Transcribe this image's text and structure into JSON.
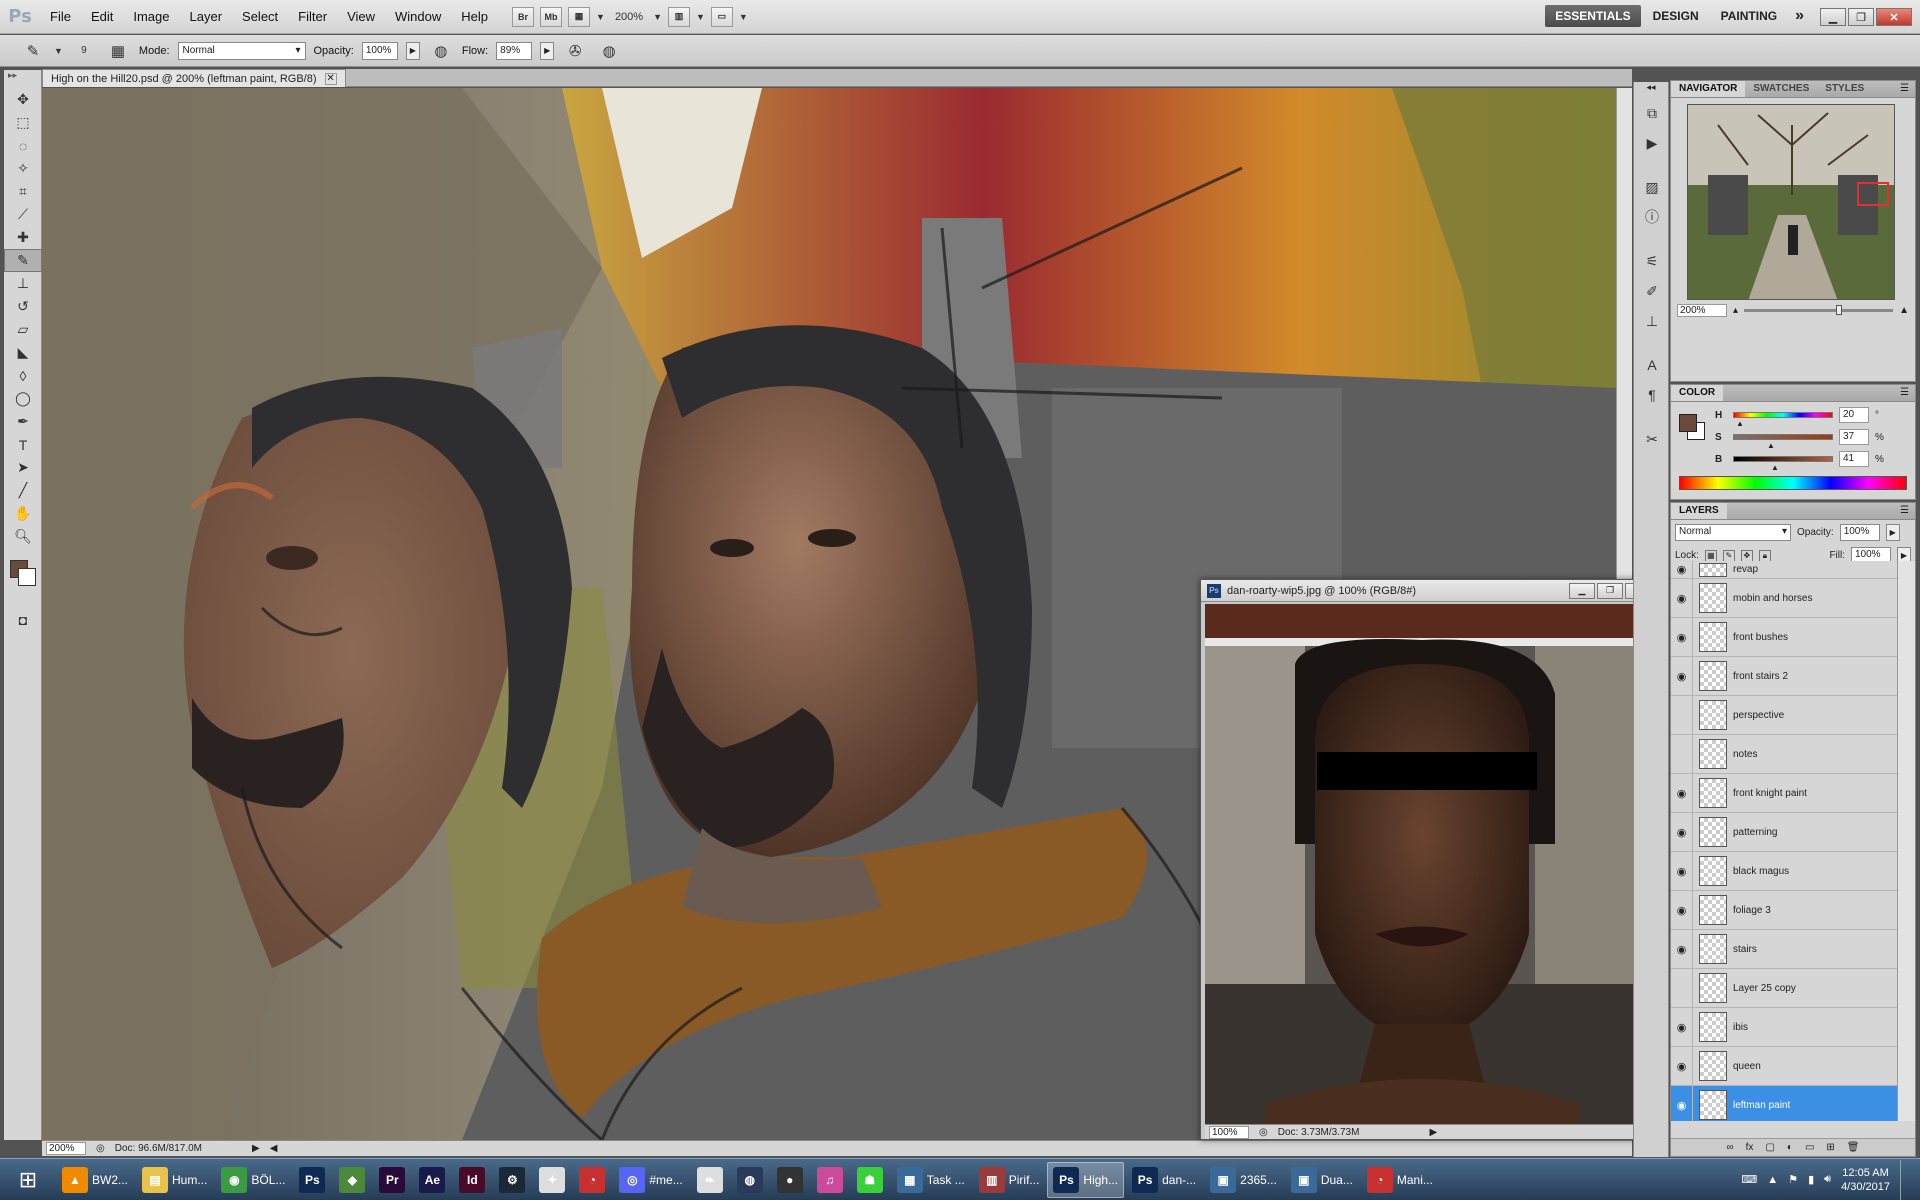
{
  "app": {
    "logo": "Ps",
    "menu": [
      "File",
      "Edit",
      "Image",
      "Layer",
      "Select",
      "Filter",
      "View",
      "Window",
      "Help"
    ],
    "menubar_tools": {
      "br": "Br",
      "mb": "Mb",
      "zoom": "200%"
    },
    "workspaces": [
      "ESSENTIALS",
      "DESIGN",
      "PAINTING"
    ],
    "workspace_more": "»"
  },
  "options_bar": {
    "brush_size": "9",
    "mode_label": "Mode:",
    "mode_value": "Normal",
    "opacity_label": "Opacity:",
    "opacity_value": "100%",
    "flow_label": "Flow:",
    "flow_value": "89%"
  },
  "document": {
    "tab_title": "High on the Hill20.psd @ 200% (leftman paint, RGB/8)",
    "zoom": "200%",
    "doc_size": "Doc: 96.6M/817.0M"
  },
  "reference_window": {
    "title": "dan-roarty-wip5.jpg @ 100% (RGB/8#)",
    "zoom": "100%",
    "doc_size": "Doc: 3.73M/3.73M"
  },
  "navigator": {
    "tabs": [
      "NAVIGATOR",
      "SWATCHES",
      "STYLES"
    ],
    "zoom": "200%"
  },
  "color_panel": {
    "title": "COLOR",
    "channels": [
      {
        "label": "H",
        "value": "20",
        "unit": "°",
        "fraction": 0.06
      },
      {
        "label": "S",
        "value": "37",
        "unit": "%",
        "fraction": 0.37
      },
      {
        "label": "B",
        "value": "41",
        "unit": "%",
        "fraction": 0.41
      }
    ],
    "foreground": "#6b4a3c"
  },
  "layers_panel": {
    "title": "LAYERS",
    "blend_mode": "Normal",
    "opacity_label": "Opacity:",
    "opacity_value": "100%",
    "lock_label": "Lock:",
    "fill_label": "Fill:",
    "fill_value": "100%",
    "layers": [
      {
        "name": "revap",
        "visible": true,
        "selected": false
      },
      {
        "name": "mobin and horses",
        "visible": true,
        "selected": false
      },
      {
        "name": "front bushes",
        "visible": true,
        "selected": false
      },
      {
        "name": "front stairs 2",
        "visible": true,
        "selected": false
      },
      {
        "name": "perspective",
        "visible": false,
        "selected": false
      },
      {
        "name": "notes",
        "visible": false,
        "selected": false
      },
      {
        "name": "front knight paint",
        "visible": true,
        "selected": false
      },
      {
        "name": "patterning",
        "visible": true,
        "selected": false
      },
      {
        "name": "black magus",
        "visible": true,
        "selected": false
      },
      {
        "name": "foliage 3",
        "visible": true,
        "selected": false
      },
      {
        "name": "stairs",
        "visible": true,
        "selected": false
      },
      {
        "name": "Layer 25 copy",
        "visible": false,
        "selected": false
      },
      {
        "name": "ibis",
        "visible": true,
        "selected": false
      },
      {
        "name": "queen",
        "visible": true,
        "selected": false
      },
      {
        "name": "leftman paint",
        "visible": true,
        "selected": true
      }
    ],
    "footer": [
      "∞",
      "fx",
      "▢",
      "◐",
      "▭",
      "⊞",
      "🗑"
    ]
  },
  "taskbar": {
    "items": [
      {
        "icon": "vlc-icon",
        "glyph": "▲",
        "color": "#f08a00",
        "label": "BW2...",
        "active": false
      },
      {
        "icon": "folder-icon",
        "glyph": "▤",
        "color": "#e8c24a",
        "label": "Hum...",
        "active": false
      },
      {
        "icon": "chrome-icon",
        "glyph": "◉",
        "color": "#3b9a42",
        "label": "BÖL...",
        "active": false
      },
      {
        "icon": "photoshop-icon",
        "glyph": "Ps",
        "color": "#0f2a52",
        "label": "",
        "active": false
      },
      {
        "icon": "maps-icon",
        "glyph": "◆",
        "color": "#4a8a3a",
        "label": "",
        "active": false
      },
      {
        "icon": "premiere-icon",
        "glyph": "Pr",
        "color": "#2a0a3a",
        "label": "",
        "active": false
      },
      {
        "icon": "after-effects-icon",
        "glyph": "Ae",
        "color": "#1a1a4a",
        "label": "",
        "active": false
      },
      {
        "icon": "indesign-icon",
        "glyph": "Id",
        "color": "#4a0a2a",
        "label": "",
        "active": false
      },
      {
        "icon": "steam-icon",
        "glyph": "⚙",
        "color": "#1b2838",
        "label": "",
        "active": false
      },
      {
        "icon": "figure-icon",
        "glyph": "✦",
        "color": "#dddddd",
        "label": "",
        "active": false
      },
      {
        "icon": "clock-app-icon",
        "glyph": "◔",
        "color": "#c83030",
        "label": "",
        "active": false
      },
      {
        "icon": "discord-icon",
        "glyph": "◎",
        "color": "#5865f2",
        "label": "#me...",
        "active": false
      },
      {
        "icon": "feather-icon",
        "glyph": "❧",
        "color": "#dddddd",
        "label": "",
        "active": false
      },
      {
        "icon": "globe-icon",
        "glyph": "◍",
        "color": "#2a3a5a",
        "label": "",
        "active": false
      },
      {
        "icon": "obs-icon",
        "glyph": "●",
        "color": "#333333",
        "label": "",
        "active": false
      },
      {
        "icon": "itunes-icon",
        "glyph": "♫",
        "color": "#cc4a9a",
        "label": "",
        "active": false
      },
      {
        "icon": "android-icon",
        "glyph": "☗",
        "color": "#3ad03a",
        "label": "",
        "active": false
      },
      {
        "icon": "task-manager-icon",
        "glyph": "▦",
        "color": "#3a6a9a",
        "label": "Task ...",
        "active": false
      },
      {
        "icon": "piriform-icon",
        "glyph": "▥",
        "color": "#9a3a3a",
        "label": "Pirif...",
        "active": false
      },
      {
        "icon": "photoshop-doc-icon",
        "glyph": "Ps",
        "color": "#0f2a52",
        "label": "High...",
        "active": true
      },
      {
        "icon": "photoshop-doc2-icon",
        "glyph": "Ps",
        "color": "#0f2a52",
        "label": "dan-...",
        "active": false
      },
      {
        "icon": "image-viewer-icon",
        "glyph": "▣",
        "color": "#3a6a9a",
        "label": "2365...",
        "active": false
      },
      {
        "icon": "display-icon",
        "glyph": "▣",
        "color": "#3a6a9a",
        "label": "Dua...",
        "active": false
      },
      {
        "icon": "mania-icon",
        "glyph": "◔",
        "color": "#c83030",
        "label": "Mani...",
        "active": false
      }
    ],
    "time": "12:05 AM",
    "date": "4/30/2017"
  }
}
